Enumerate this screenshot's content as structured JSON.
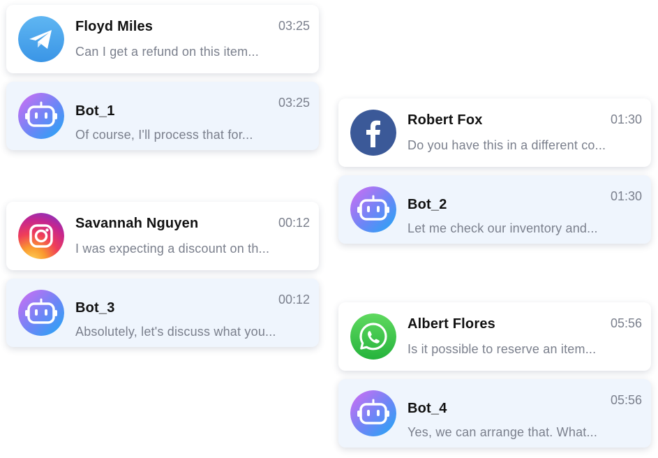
{
  "conversations": [
    {
      "name": "Floyd Miles",
      "time": "03:25",
      "message": "Can I get a refund on this item...",
      "channel_icon": "telegram-icon"
    },
    {
      "name": "Bot_1",
      "time": "03:25",
      "message": "Of course, I'll process that for...",
      "channel_icon": "bot-icon"
    },
    {
      "name": "Savannah Nguyen",
      "time": "00:12",
      "message": "I was expecting a discount on th...",
      "channel_icon": "instagram-icon"
    },
    {
      "name": "Bot_3",
      "time": "00:12",
      "message": "Absolutely, let's discuss what you...",
      "channel_icon": "bot-icon"
    },
    {
      "name": "Robert Fox",
      "time": "01:30",
      "message": "Do you have this in a different co...",
      "channel_icon": "facebook-icon"
    },
    {
      "name": "Bot_2",
      "time": "01:30",
      "message": "Let me check our inventory and...",
      "channel_icon": "bot-icon"
    },
    {
      "name": "Albert Flores",
      "time": "05:56",
      "message": "Is it possible to reserve an item...",
      "channel_icon": "whatsapp-icon"
    },
    {
      "name": "Bot_4",
      "time": "05:56",
      "message": "Yes, we can arrange that. What...",
      "channel_icon": "bot-icon"
    }
  ],
  "colors": {
    "telegram": "#4aa3ec",
    "facebook": "#3b5998",
    "whatsapp": "#3cc34f",
    "bot_gradient_start": "#c468f0",
    "bot_gradient_end": "#2f9ff5",
    "card_bot_bg": "#eff5fd"
  }
}
